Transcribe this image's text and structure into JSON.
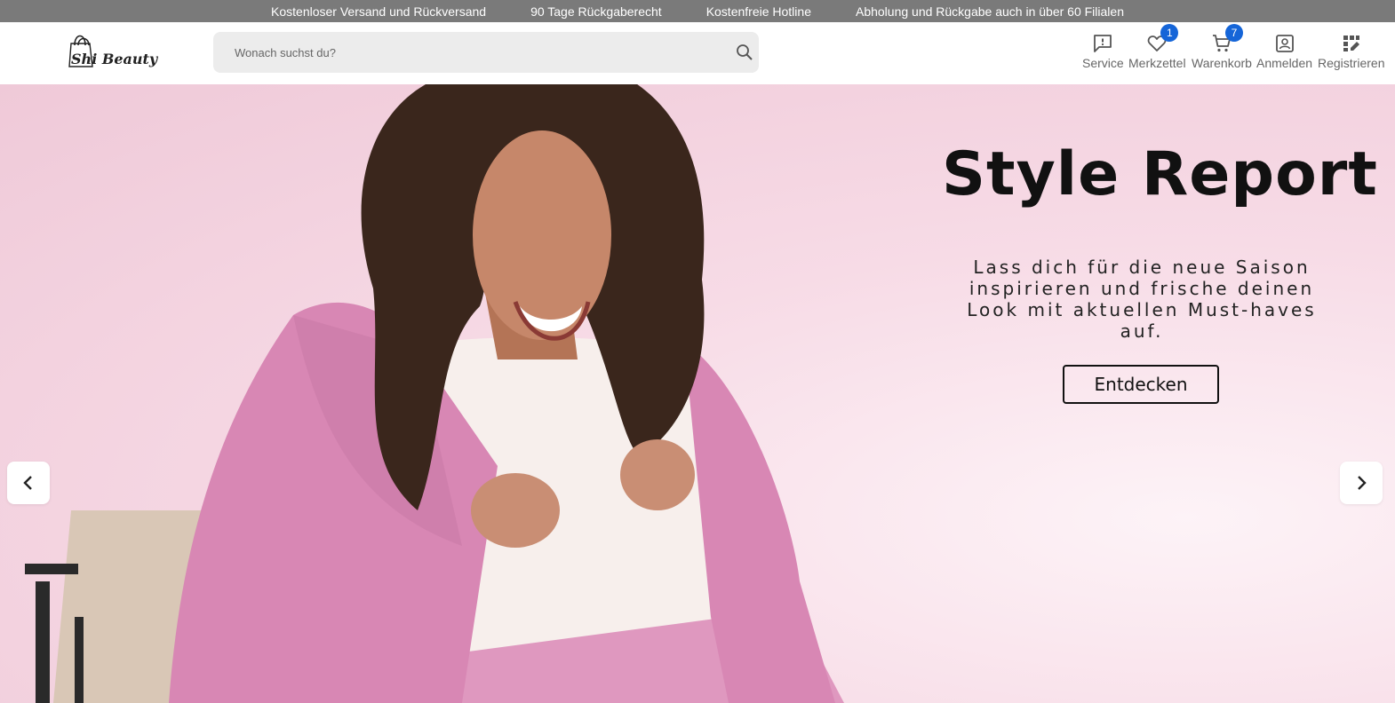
{
  "topbar": {
    "items": [
      "Kostenloser Versand und Rückversand",
      "90 Tage Rückgaberecht",
      "Kostenfreie Hotline",
      "Abholung und Rückgabe auch in über 60 Filialen"
    ]
  },
  "header": {
    "logo_text": "Shi Beauty",
    "search_placeholder": "Wonach suchst du?",
    "nav": [
      {
        "label": "Service",
        "icon": "message-alert-icon"
      },
      {
        "label": "Merkzettel",
        "icon": "heart-icon",
        "badge": "1"
      },
      {
        "label": "Warenkorb",
        "icon": "cart-icon",
        "badge": "7"
      },
      {
        "label": "Anmelden",
        "icon": "user-icon"
      },
      {
        "label": "Registrieren",
        "icon": "register-icon"
      }
    ],
    "badge_color": "#1565d8"
  },
  "hero": {
    "title": "Style Report",
    "subtitle": "Lass dich für die neue Saison inspirieren und frische deinen Look mit aktuellen Must-haves auf.",
    "cta_label": "Entdecken"
  },
  "colors": {
    "topbar_bg": "#7a7a7a",
    "hero_bg": "#f3d3e0",
    "blazer": "#d98bb6"
  }
}
